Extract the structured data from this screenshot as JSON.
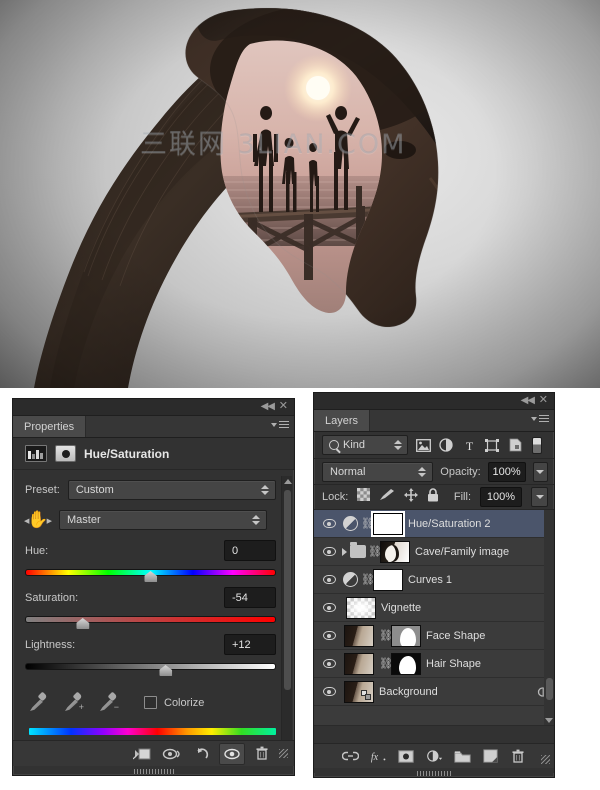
{
  "artwork": {
    "watermark": "三联网 3LIAN.COM",
    "description": "Double exposure of a woman's profile silhouette containing a beach sunset scene with a family on a pier"
  },
  "properties_panel": {
    "tab_label": "Properties",
    "title": "Hue/Saturation",
    "collapse_label": "◀◀",
    "close_label": "✕",
    "preset": {
      "label": "Preset:",
      "value": "Custom"
    },
    "channel": {
      "value": "Master"
    },
    "hue": {
      "label": "Hue:",
      "value": "0",
      "position_pct": 50
    },
    "saturation": {
      "label": "Saturation:",
      "value": "-54",
      "position_pct": 23
    },
    "lightness": {
      "label": "Lightness:",
      "value": "+12",
      "position_pct": 56
    },
    "colorize": {
      "label": "Colorize",
      "checked": false
    },
    "eyedroppers": [
      "eyedropper",
      "eyedropper-add",
      "eyedropper-subtract"
    ],
    "footer_buttons": [
      {
        "name": "clip-to-layer",
        "label": "clip-icon"
      },
      {
        "name": "view-previous-state",
        "label": "eye-prev-icon"
      },
      {
        "name": "reset",
        "label": "reset-icon"
      },
      {
        "name": "toggle-visibility",
        "label": "eye-icon",
        "active": true
      },
      {
        "name": "delete",
        "label": "trash-icon"
      }
    ]
  },
  "layers_panel": {
    "tab_label": "Layers",
    "collapse_label": "◀◀",
    "close_label": "✕",
    "filter": {
      "kind_label": "Kind",
      "icons": [
        "pixel-layer-filter",
        "adjustment-layer-filter",
        "type-layer-filter",
        "shape-layer-filter",
        "smart-object-filter"
      ],
      "toggle_name": "filter-enable-toggle"
    },
    "blend": {
      "mode": "Normal",
      "opacity_label": "Opacity:",
      "opacity_value": "100%"
    },
    "lock": {
      "label": "Lock:",
      "fill_label": "Fill:",
      "fill_value": "100%",
      "icons": [
        "lock-transparent-pixels",
        "lock-image-pixels",
        "lock-position",
        "lock-all"
      ]
    },
    "layers": [
      {
        "name": "Hue/Saturation 2",
        "type": "adjustment",
        "selected": true,
        "visible": true,
        "linked": true,
        "thumb": "white-mask"
      },
      {
        "name": "Cave/Family image",
        "type": "group",
        "selected": false,
        "visible": true,
        "linked": true,
        "thumb": "cave"
      },
      {
        "name": "Curves 1",
        "type": "adjustment",
        "selected": false,
        "visible": true,
        "linked": true,
        "thumb": "white-mask"
      },
      {
        "name": "Vignette",
        "type": "pixel",
        "selected": false,
        "visible": true,
        "linked": false,
        "thumb": "checker"
      },
      {
        "name": "Face Shape",
        "type": "pixel",
        "selected": false,
        "visible": true,
        "linked": true,
        "thumb": "face",
        "mask": "face-mask"
      },
      {
        "name": "Hair Shape",
        "type": "pixel",
        "selected": false,
        "visible": true,
        "linked": true,
        "thumb": "face",
        "mask": "hair-mask"
      },
      {
        "name": "Background",
        "type": "background",
        "selected": false,
        "visible": true,
        "linked": false,
        "thumb": "face",
        "locked": true
      }
    ],
    "footer_buttons": [
      {
        "name": "link-layers",
        "label": "link-icon"
      },
      {
        "name": "layer-style",
        "label": "fx-icon"
      },
      {
        "name": "add-layer-mask",
        "label": "mask-icon"
      },
      {
        "name": "new-adjustment-layer",
        "label": "adjustment-icon"
      },
      {
        "name": "new-group",
        "label": "folder-icon"
      },
      {
        "name": "new-layer",
        "label": "new-layer-icon"
      },
      {
        "name": "delete-layer",
        "label": "trash-icon"
      }
    ]
  },
  "colors": {
    "panel_bg": "#323232",
    "selected_row": "#4b556b",
    "text": "#d8d8d8",
    "field_bg": "#1d1d1d"
  }
}
